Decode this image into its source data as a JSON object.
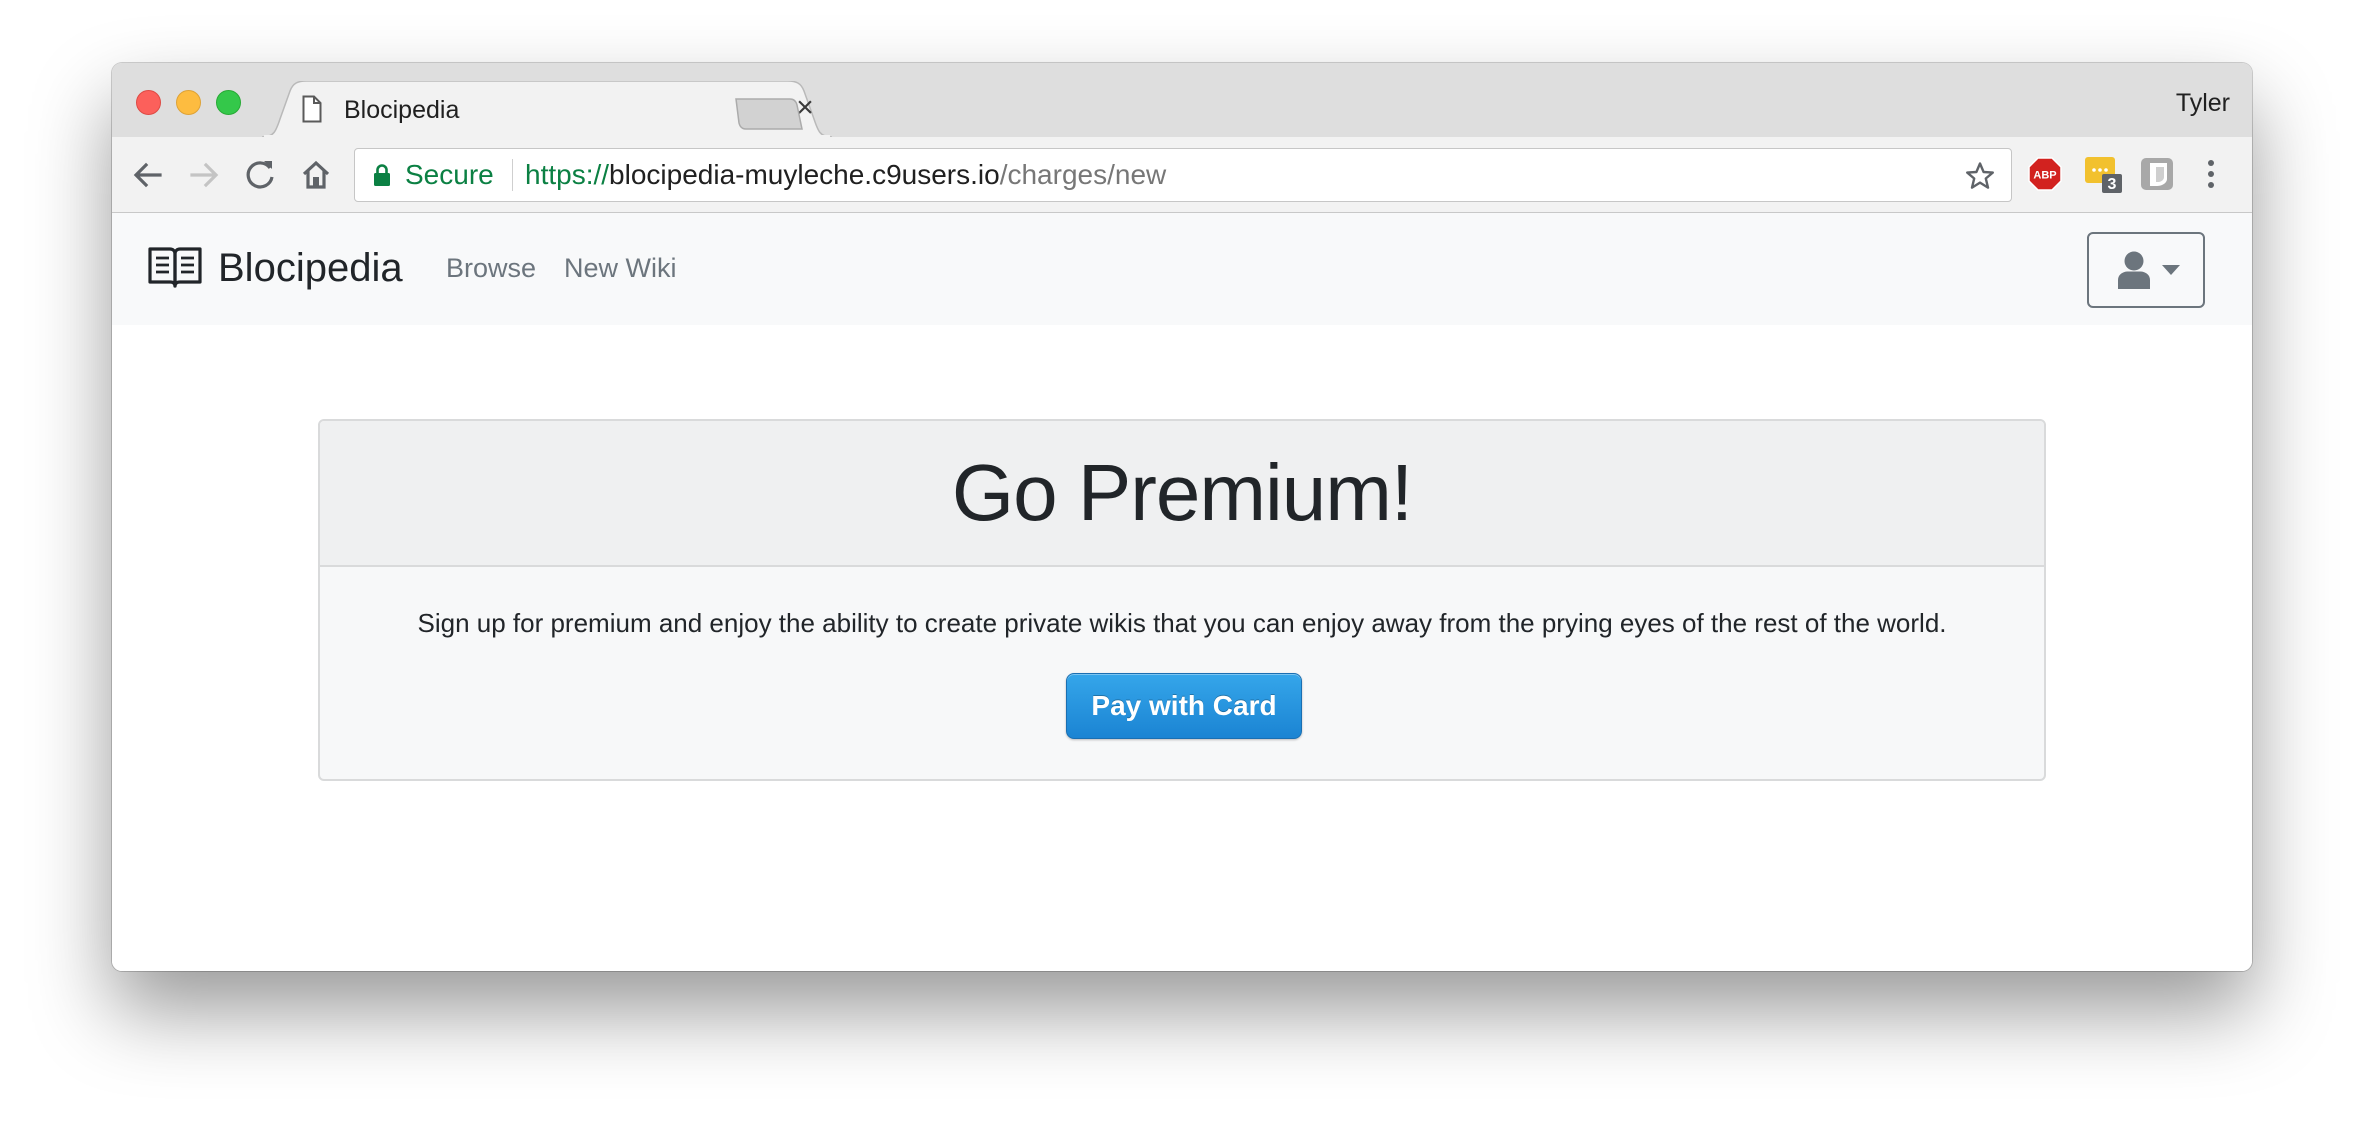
{
  "browser": {
    "tab_title": "Blocipedia",
    "tab_close_glyph": "×",
    "profile_name": "Tyler",
    "secure_label": "Secure",
    "url_scheme": "https://",
    "url_host": "blocipedia-muyleche.c9users.io",
    "url_path": "/charges/new",
    "extensions": [
      {
        "name": "adblock-plus",
        "label": "ABP",
        "color": "#d2221f"
      },
      {
        "name": "notes-extension",
        "badge": "3",
        "color": "#f2c12e"
      },
      {
        "name": "shield-extension",
        "color": "#9e9e9e"
      }
    ],
    "icons": [
      "back-arrow-icon",
      "forward-arrow-icon",
      "reload-icon",
      "home-icon",
      "lock-icon",
      "star-icon",
      "menu-dots-icon"
    ]
  },
  "navbar": {
    "brand": "Blocipedia",
    "links": [
      "Browse",
      "New Wiki"
    ],
    "user_menu_icon": "user-icon"
  },
  "card": {
    "title": "Go Premium!",
    "text": "Sign up for premium and enjoy the ability to create private wikis that you can enjoy away from the prying eyes of the rest of the world.",
    "button_label": "Pay with Card"
  },
  "colors": {
    "secure_green": "#0b8043",
    "button_blue": "#1b84d3",
    "navbar_bg": "#f8f9fa",
    "nav_link": "#6c757d"
  }
}
